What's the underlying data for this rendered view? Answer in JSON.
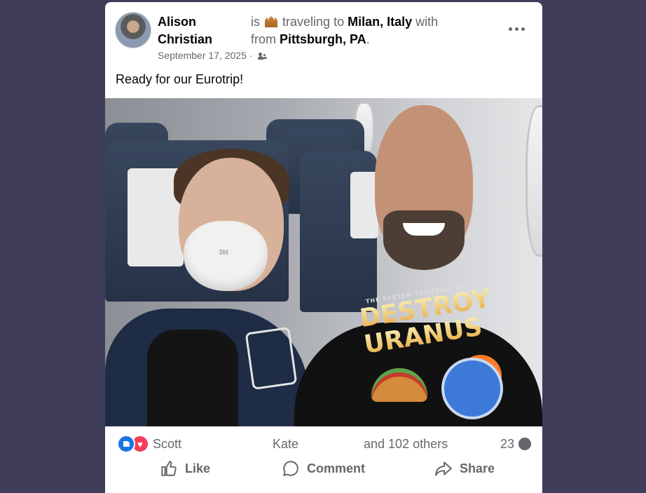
{
  "post": {
    "author_line1": "Alison",
    "author_line2": "Christian",
    "activity_is": "is",
    "activity_traveling": "traveling to",
    "destination": "Milan, Italy",
    "activity_with": "with",
    "activity_from": "from",
    "origin": "Pittsburgh, PA",
    "origin_suffix": ".",
    "date": "September 17, 2025 ·",
    "audience_icon": "friends-icon",
    "text": "Ready for our Eurotrip!",
    "photo_shirt_small": "THE SYSTEM TREMBLES AS TACOS",
    "photo_shirt_line1": "DESTROY",
    "photo_shirt_line2": "URANUS",
    "photo_mask_text": "3M"
  },
  "reactions": {
    "icons": [
      "like-icon",
      "love-icon"
    ],
    "name1": "Scott",
    "name2": "Kate",
    "others": "and 102 others",
    "comment_count": "23"
  },
  "actions": {
    "like": "Like",
    "comment": "Comment",
    "share": "Share"
  },
  "colors": {
    "background": "#403d59",
    "card": "#ffffff",
    "secondary_text": "#65676b",
    "like_blue": "#1b74e4",
    "love_red": "#f33e58"
  }
}
